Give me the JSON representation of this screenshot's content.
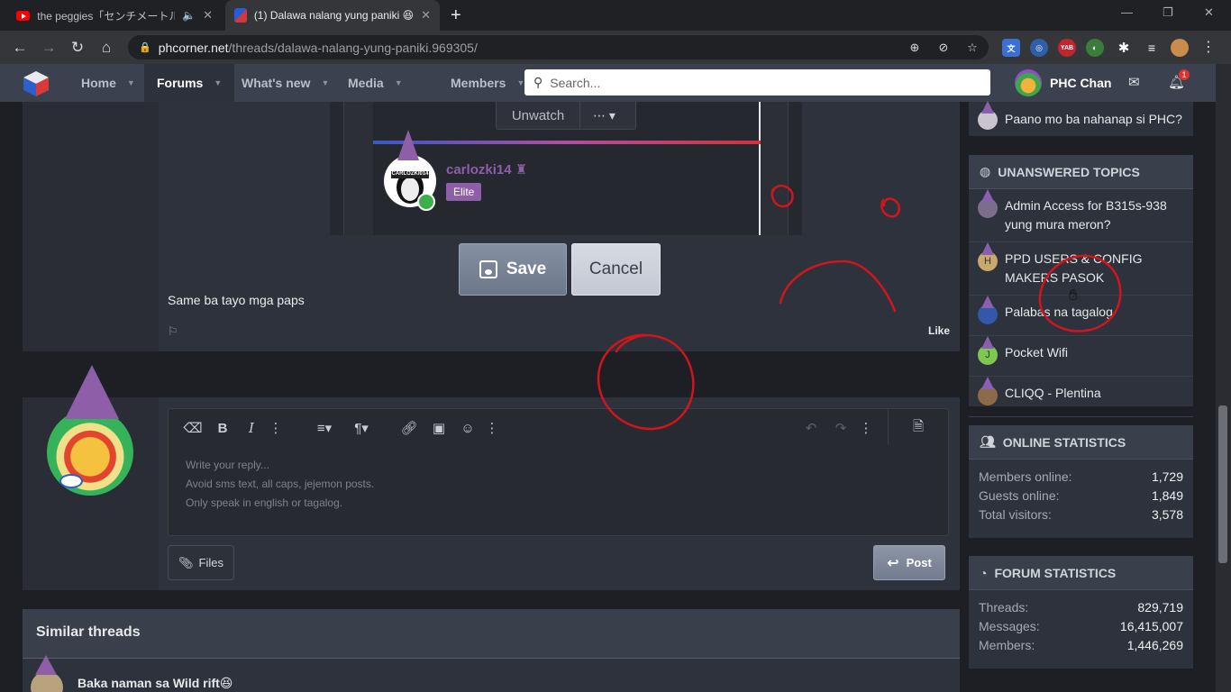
{
  "browser": {
    "tabs": [
      {
        "title": "the peggies「センチメートル」Mu",
        "active": false
      },
      {
        "title": "(1) Dalawa nalang yung paniki 😆",
        "active": true
      }
    ],
    "new_tab": "+",
    "window_controls": {
      "minimize": "—",
      "restore": "❐",
      "close": "✕"
    },
    "url_domain": "phcorner.net",
    "url_path": "/threads/dalawa-nalang-yung-paniki.969305/",
    "ext_badge": "YAB"
  },
  "site": {
    "nav": [
      {
        "label": "Home"
      },
      {
        "label": "Forums",
        "active": true
      },
      {
        "label": "What's new"
      },
      {
        "label": "Media"
      },
      {
        "label": "Members"
      }
    ],
    "search_placeholder": "Search...",
    "username": "PHC Chan",
    "alerts_count": "1"
  },
  "post": {
    "embedded": {
      "unwatch": "Unwatch",
      "more": "⋯",
      "username": "carlozki14",
      "role": "Elite",
      "avatar_text": "CARLOZKI014"
    },
    "save_label": "Save",
    "cancel_label": "Cancel",
    "text": "Same ba tayo mga paps",
    "like": "Like"
  },
  "reply": {
    "placeholder_lines": [
      "Write your reply...",
      "Avoid sms text, all caps, jejemon posts.",
      "Only speak in english or tagalog."
    ],
    "files_label": "Files",
    "post_label": "Post"
  },
  "similar": {
    "heading": "Similar threads",
    "first_thread": "Baka naman sa Wild rift😆"
  },
  "sidebar": {
    "top_item": "Paano mo ba nahanap si PHC?",
    "unanswered": {
      "heading": "UNANSWERED TOPICS",
      "items": [
        {
          "title": "Admin Access for B315s-938 yung mura meron?",
          "avatar": "",
          "color": "#7a6e8c"
        },
        {
          "title": "PPD USERS & CONFIG MAKERS PASOK",
          "avatar": "H",
          "color": "#c8a96b"
        },
        {
          "title": "Palabas na tagalog",
          "avatar": "",
          "color": "#3557a8"
        },
        {
          "title": "Pocket Wifi",
          "avatar": "J",
          "color": "#7ec850"
        },
        {
          "title": "CLIQQ - Plentina",
          "avatar": "",
          "color": "#8c6a4a"
        }
      ]
    },
    "online": {
      "heading": "ONLINE STATISTICS",
      "rows": [
        {
          "k": "Members online:",
          "v": "1,729"
        },
        {
          "k": "Guests online:",
          "v": "1,849"
        },
        {
          "k": "Total visitors:",
          "v": "3,578"
        }
      ]
    },
    "forum": {
      "heading": "FORUM STATISTICS",
      "rows": [
        {
          "k": "Threads:",
          "v": "829,719"
        },
        {
          "k": "Messages:",
          "v": "16,415,007"
        },
        {
          "k": "Members:",
          "v": "1,446,269"
        }
      ]
    }
  },
  "colors": {
    "accent": "#8e5ea8",
    "annotation": "#d0161c"
  }
}
